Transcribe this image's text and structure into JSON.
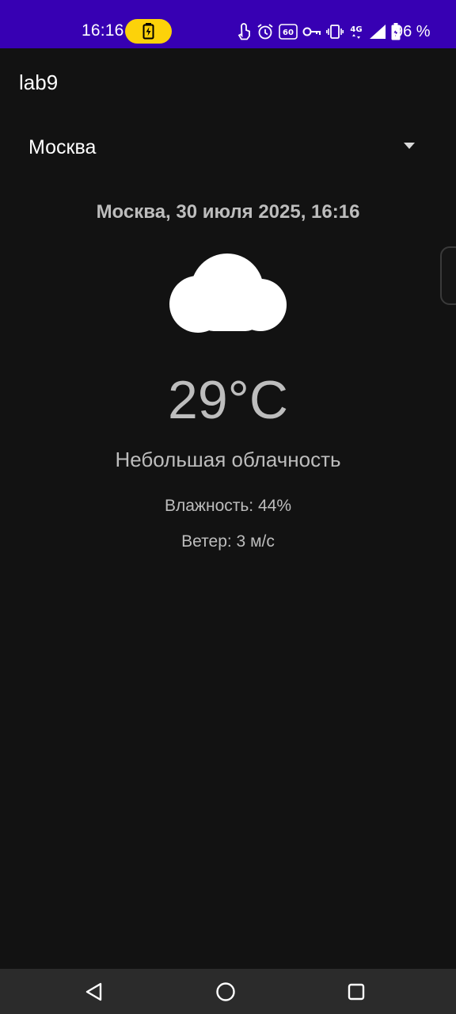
{
  "status_bar": {
    "time": "16:16",
    "battery_percent": "96 %",
    "background_color": "#3700b3",
    "battery_pill_color": "#fcd20a",
    "icons": [
      "battery-charging-icon",
      "touch-icon",
      "alarm-icon",
      "60hz-icon",
      "key-icon",
      "vibrate-icon",
      "4g-icon",
      "signal-icon",
      "battery-icon"
    ]
  },
  "app": {
    "title": "lab9"
  },
  "city_selector": {
    "selected": "Москва"
  },
  "weather": {
    "date_line": "Москва, 30 июля 2025, 16:16",
    "icon": "cloud-icon",
    "temperature": "29°C",
    "description": "Небольшая облачность",
    "humidity": "Влажность: 44%",
    "wind": "Ветер: 3 м/с"
  },
  "nav_bar": {
    "icons": [
      "back-icon",
      "home-icon",
      "recents-icon"
    ]
  }
}
